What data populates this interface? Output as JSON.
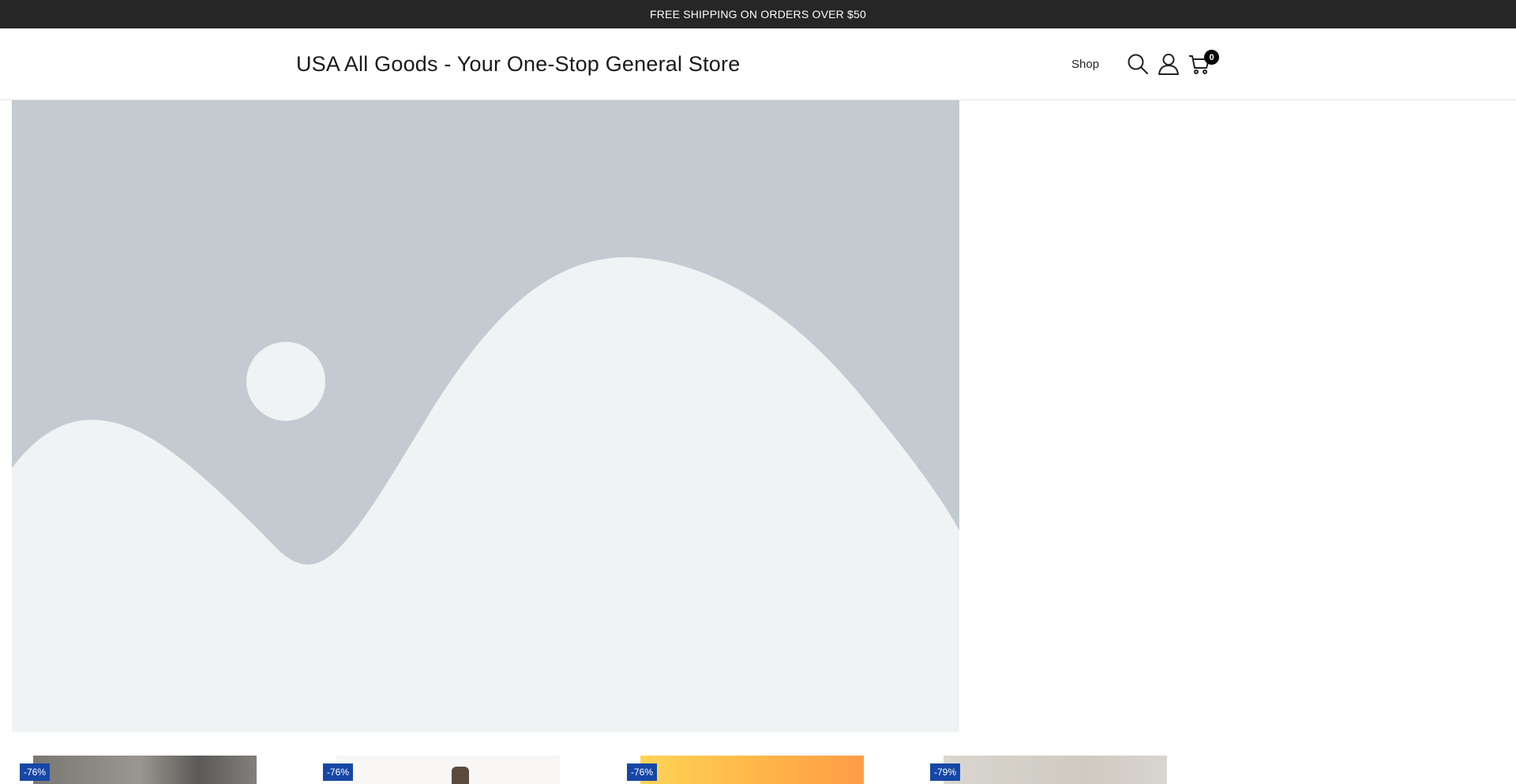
{
  "announcement": {
    "text": "FREE SHIPPING ON ORDERS OVER $50"
  },
  "header": {
    "logo_text": "USA All Goods - Your One-Stop General Store",
    "nav": [
      {
        "label": "Shop"
      }
    ],
    "icons": {
      "search": "search-icon",
      "account": "user-icon",
      "cart": "cart-icon"
    },
    "cart_count": "0"
  },
  "hero": {
    "image": "placeholder-image"
  },
  "products": [
    {
      "badge": "-76%"
    },
    {
      "badge": "-76%"
    },
    {
      "badge": "-76%"
    },
    {
      "badge": "-79%"
    }
  ],
  "colors": {
    "announcement_bg": "#262626",
    "badge_bg": "#1747a6",
    "placeholder_bg": "#c3cbd1",
    "placeholder_fg": "#f0f3f4"
  }
}
